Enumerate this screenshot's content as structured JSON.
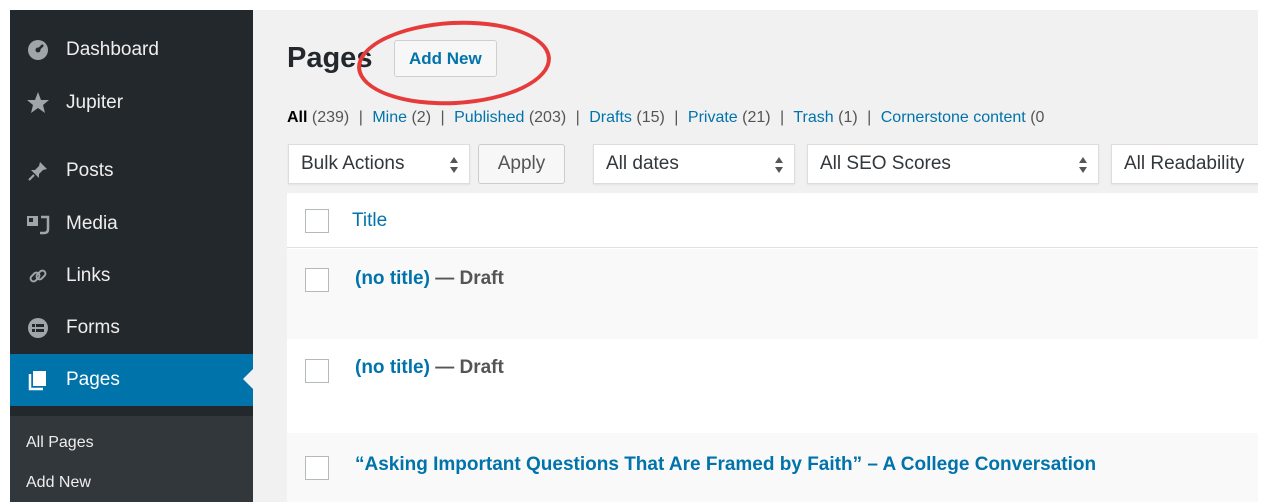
{
  "sidebar": {
    "items": [
      {
        "label": "Dashboard",
        "icon": "dashboard-icon"
      },
      {
        "label": "Jupiter",
        "icon": "star-icon"
      },
      {
        "label": "Posts",
        "icon": "pin-icon"
      },
      {
        "label": "Media",
        "icon": "media-icon"
      },
      {
        "label": "Links",
        "icon": "link-icon"
      },
      {
        "label": "Forms",
        "icon": "forms-icon"
      },
      {
        "label": "Pages",
        "icon": "pages-icon"
      }
    ],
    "submenu": [
      {
        "label": "All Pages"
      },
      {
        "label": "Add New"
      }
    ]
  },
  "header": {
    "title": "Pages",
    "add_new_label": "Add New"
  },
  "filters": {
    "all_label": "All",
    "all_count": "(239)",
    "mine_label": "Mine",
    "mine_count": "(2)",
    "published_label": "Published",
    "published_count": "(203)",
    "drafts_label": "Drafts",
    "drafts_count": "(15)",
    "private_label": "Private",
    "private_count": "(21)",
    "trash_label": "Trash",
    "trash_count": "(1)",
    "cornerstone_label": "Cornerstone content",
    "cornerstone_count": "(0",
    "separator": "|"
  },
  "toolbar": {
    "bulk_actions": "Bulk Actions",
    "apply_label": "Apply",
    "dates": "All dates",
    "seo_scores": "All SEO Scores",
    "readability": "All Readability"
  },
  "table": {
    "header_title": "Title",
    "rows": [
      {
        "title": "(no title)",
        "state": " — Draft"
      },
      {
        "title": "(no title)",
        "state": " — Draft"
      },
      {
        "title": "“Asking Important Questions That Are Framed by Faith” – A College Conversation",
        "state": ""
      }
    ]
  },
  "colors": {
    "sidebar_bg": "#23282d",
    "active_bg": "#0073aa",
    "link": "#0073aa",
    "highlight_ellipse": "#e63b3b"
  }
}
